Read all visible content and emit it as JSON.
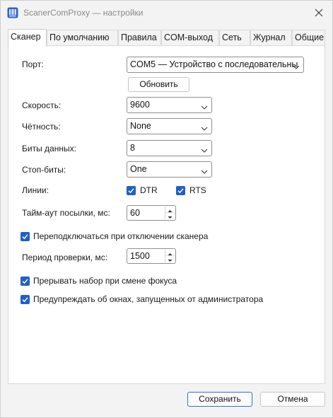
{
  "window": {
    "title": "ScanerComProxy — настройки"
  },
  "tabs": [
    {
      "label": "Сканер"
    },
    {
      "label": "По умолчанию"
    },
    {
      "label": "Правила"
    },
    {
      "label": "COM-выход"
    },
    {
      "label": "Сеть"
    },
    {
      "label": "Журнал"
    },
    {
      "label": "Общие"
    }
  ],
  "scanner": {
    "port_label": "Порт:",
    "port_value": "COM5 — Устройство с последовательны",
    "refresh_label": "Обновить",
    "speed_label": "Скорость:",
    "speed_value": "9600",
    "parity_label": "Чётность:",
    "parity_value": "None",
    "databits_label": "Биты данных:",
    "databits_value": "8",
    "stopbits_label": "Стоп-биты:",
    "stopbits_value": "One",
    "lines_label": "Линии:",
    "dtr_label": "DTR",
    "rts_label": "RTS",
    "timeout_label": "Тайм-аут посылки, мс:",
    "timeout_value": "60",
    "reconnect_label": "Переподключаться при отключении сканера",
    "period_label": "Период проверки, мс:",
    "period_value": "1500",
    "interrupt_label": "Прерывать набор при смене фокуса",
    "warn_label": "Предупреждать об окнах, запущенных от администратора"
  },
  "footer": {
    "save_label": "Сохранить",
    "cancel_label": "Отмена"
  },
  "colors": {
    "accent": "#1f5fc7",
    "panel": "#ffffff",
    "window": "#f3f3f3"
  }
}
